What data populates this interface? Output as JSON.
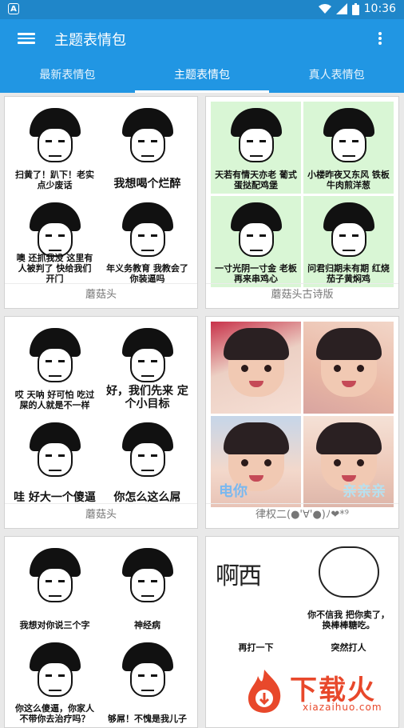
{
  "status": {
    "time": "10:36",
    "notification_icon": "A",
    "icons": [
      "wifi-icon",
      "signal-icon",
      "battery-icon"
    ]
  },
  "appbar": {
    "title": "主题表情包"
  },
  "tabs": [
    {
      "label": "最新表情包"
    },
    {
      "label": "主题表情包",
      "active": true
    },
    {
      "label": "真人表情包"
    }
  ],
  "cards": [
    {
      "label": "蘑菇头",
      "captions": [
        "扫黄了！趴下！老实点少废话",
        "我想喝个烂醉",
        "噢 还抓我没 这里有人被判了 快给我们 开门",
        "年义务教育 我教会了你装逼吗"
      ]
    },
    {
      "label": "蘑菇头古诗版",
      "captions": [
        "天若有情天亦老 葡式蛋挞配鸡堡",
        "小楼昨夜又东风 铁板牛肉煎洋葱",
        "一寸光阴一寸金 老板再来串鸡心",
        "问君归期未有期 红烧茄子黄焖鸡"
      ]
    },
    {
      "label": "蘑菇头",
      "captions": [
        "哎 天呐 好可怕 吃过屎的人就是不一样",
        "好，我们先来 定个小目标",
        "哇 好大一个傻逼",
        "你怎么这么屌"
      ]
    },
    {
      "label": "律权二(●'∀'●)ﾉ❤*⁹",
      "captions": [
        "",
        "",
        "电你",
        "亲亲亲"
      ]
    },
    {
      "label": "",
      "captions": [
        "我想对你说三个字",
        "神经病",
        "你这么傻逼，你家人不带你去治疗吗？",
        "够屌！不愧是我儿子"
      ]
    },
    {
      "label": "",
      "captions": [
        "啊西",
        "你不信我 把你卖了，换棒棒糖吃。",
        "再打一下",
        "突然打人"
      ]
    }
  ],
  "watermark": {
    "brand": "下载火",
    "url": "xiazaihuo.com"
  }
}
